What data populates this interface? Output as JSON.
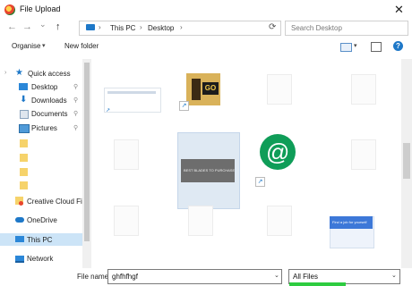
{
  "window": {
    "title": "File Upload",
    "close_glyph": "✕"
  },
  "nav": {
    "back_glyph": "←",
    "forward_glyph": "→",
    "dropdown_glyph": "⌄",
    "up_glyph": "↑",
    "breadcrumb": [
      "This PC",
      "Desktop"
    ],
    "separator": "›",
    "refresh_glyph": "⟳",
    "search_placeholder": "Search Desktop"
  },
  "toolbar": {
    "organise_label": "Organise",
    "new_folder_label": "New folder",
    "caret": "▾",
    "help_glyph": "?"
  },
  "sidebar": {
    "items": [
      {
        "label": "Quick access",
        "icon": "star-icon"
      },
      {
        "label": "Desktop",
        "icon": "desktop-icon",
        "pinned": true
      },
      {
        "label": "Downloads",
        "icon": "downloads-icon",
        "pinned": true
      },
      {
        "label": "Documents",
        "icon": "documents-icon",
        "pinned": true
      },
      {
        "label": "Pictures",
        "icon": "pictures-icon",
        "pinned": true
      },
      {
        "label": "Creative Cloud Fil",
        "icon": "creative-cloud-icon"
      },
      {
        "label": "OneDrive",
        "icon": "onedrive-icon"
      },
      {
        "label": "This PC",
        "icon": "pc-icon",
        "selected": true
      },
      {
        "label": "Network",
        "icon": "network-icon"
      }
    ],
    "pin_glyph": "📌"
  },
  "files": {
    "thumbnail_text": "BEST BLADES TO PURCHASE",
    "game_logo_text": "GO",
    "at_symbol": "@",
    "banner_caption": "Find a job for yourself"
  },
  "bottom": {
    "filename_label": "File name:",
    "filename_value": "ghfhfhgf",
    "filter_value": "All Files",
    "caret": "⌄"
  },
  "colors": {
    "accent": "#1e78c8",
    "selection": "#cce4f7",
    "highlight": "#2ecc40",
    "hangouts_green": "#0f9d58"
  }
}
